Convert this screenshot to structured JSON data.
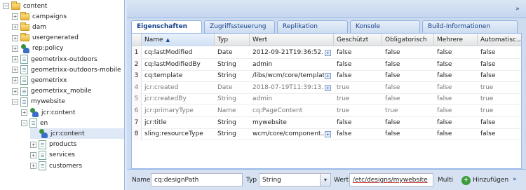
{
  "tree": [
    {
      "label": "content",
      "toggle": "−",
      "icon": "folder-icon",
      "depth": 0
    },
    {
      "label": "campaigns",
      "toggle": "+",
      "icon": "folder-icon",
      "depth": 1
    },
    {
      "label": "dam",
      "toggle": "+",
      "icon": "folder-icon",
      "depth": 1
    },
    {
      "label": "usergenerated",
      "toggle": "+",
      "icon": "folder-icon",
      "depth": 1
    },
    {
      "label": "rep:policy",
      "toggle": "+",
      "icon": "node-icon",
      "depth": 1
    },
    {
      "label": "geometrixx-outdoors",
      "toggle": "+",
      "icon": "page-icon",
      "depth": 1
    },
    {
      "label": "geometrixx-outdoors-mobile",
      "toggle": "+",
      "icon": "page-icon",
      "depth": 1
    },
    {
      "label": "geometrixx",
      "toggle": "+",
      "icon": "page-icon",
      "depth": 1
    },
    {
      "label": "geometrixx_mobile",
      "toggle": "+",
      "icon": "page-icon",
      "depth": 1
    },
    {
      "label": "mywebsite",
      "toggle": "−",
      "icon": "page-icon",
      "depth": 1
    },
    {
      "label": "jcr:content",
      "toggle": "+",
      "icon": "node-icon",
      "depth": 2
    },
    {
      "label": "en",
      "toggle": "−",
      "icon": "page-icon",
      "depth": 2
    },
    {
      "label": "jcr:content",
      "toggle": "",
      "icon": "node-icon",
      "depth": 3,
      "selected": true
    },
    {
      "label": "products",
      "toggle": "+",
      "icon": "page-icon",
      "depth": 3
    },
    {
      "label": "services",
      "toggle": "+",
      "icon": "page-icon",
      "depth": 3
    },
    {
      "label": "customers",
      "toggle": "+",
      "icon": "page-icon",
      "depth": 3
    }
  ],
  "toolbar": {
    "collapse_glyph": "»"
  },
  "tabs": [
    "Eigenschaften",
    "Zugriffssteuerung",
    "Replikation",
    "Konsole",
    "Build-Informationen"
  ],
  "active_tab": 0,
  "grid": {
    "columns": [
      "",
      "Name",
      "Typ",
      "Wert",
      "Geschützt",
      "Obligatorisch",
      "Mehrere",
      "Automatisc..."
    ],
    "sort_indicator": "▲",
    "expand_glyph": "+",
    "rows": [
      {
        "num": "1",
        "name": "cq:lastModified",
        "type": "Date",
        "value": "2012-09-21T19:36:52....",
        "expand": true,
        "protected": "false",
        "mandatory": "false",
        "multiple": "false",
        "auto": "false",
        "gray": false
      },
      {
        "num": "2",
        "name": "cq:lastModifiedBy",
        "type": "String",
        "value": "admin",
        "expand": false,
        "protected": "false",
        "mandatory": "false",
        "multiple": "false",
        "auto": "false",
        "gray": false
      },
      {
        "num": "3",
        "name": "cq:template",
        "type": "String",
        "value": "/libs/wcm/core/templat...",
        "expand": true,
        "protected": "false",
        "mandatory": "false",
        "multiple": "false",
        "auto": "false",
        "gray": false
      },
      {
        "num": "4",
        "name": "jcr:created",
        "type": "Date",
        "value": "2018-07-19T11:39:13....",
        "expand": true,
        "protected": "true",
        "mandatory": "false",
        "multiple": "false",
        "auto": "true",
        "gray": true
      },
      {
        "num": "5",
        "name": "jcr:createdBy",
        "type": "String",
        "value": "admin",
        "expand": false,
        "protected": "true",
        "mandatory": "false",
        "multiple": "false",
        "auto": "true",
        "gray": true
      },
      {
        "num": "6",
        "name": "jcr:primaryType",
        "type": "Name",
        "value": "cq:PageContent",
        "expand": false,
        "protected": "true",
        "mandatory": "true",
        "multiple": "false",
        "auto": "true",
        "gray": true
      },
      {
        "num": "7",
        "name": "jcr:title",
        "type": "String",
        "value": "mywebsite",
        "expand": false,
        "protected": "false",
        "mandatory": "false",
        "multiple": "false",
        "auto": "false",
        "gray": false
      },
      {
        "num": "8",
        "name": "sling:resourceType",
        "type": "String",
        "value": "wcm/core/component...",
        "expand": true,
        "protected": "false",
        "mandatory": "false",
        "multiple": "false",
        "auto": "false",
        "gray": false
      }
    ]
  },
  "bottom": {
    "name_label": "Name",
    "name_value": "cq:designPath",
    "type_label": "Typ",
    "type_value": "String",
    "value_label": "Wert",
    "value_value": "/etc/designs/mywebsite",
    "multi_label": "Multi",
    "add_label": "Hinzufügen",
    "add_icon_glyph": "+",
    "more_glyph": "»",
    "combo_glyph": "▾"
  }
}
